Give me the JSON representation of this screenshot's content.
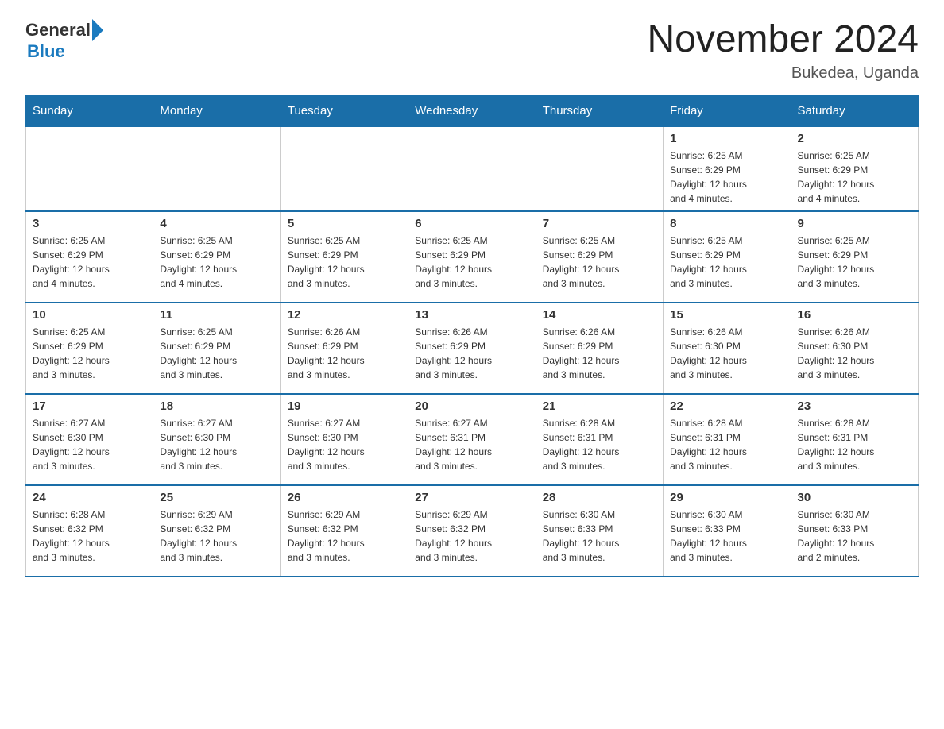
{
  "header": {
    "logo_general": "General",
    "logo_blue": "Blue",
    "title": "November 2024",
    "location": "Bukedea, Uganda"
  },
  "days_of_week": [
    "Sunday",
    "Monday",
    "Tuesday",
    "Wednesday",
    "Thursday",
    "Friday",
    "Saturday"
  ],
  "weeks": [
    [
      {
        "day": "",
        "info": ""
      },
      {
        "day": "",
        "info": ""
      },
      {
        "day": "",
        "info": ""
      },
      {
        "day": "",
        "info": ""
      },
      {
        "day": "",
        "info": ""
      },
      {
        "day": "1",
        "info": "Sunrise: 6:25 AM\nSunset: 6:29 PM\nDaylight: 12 hours\nand 4 minutes."
      },
      {
        "day": "2",
        "info": "Sunrise: 6:25 AM\nSunset: 6:29 PM\nDaylight: 12 hours\nand 4 minutes."
      }
    ],
    [
      {
        "day": "3",
        "info": "Sunrise: 6:25 AM\nSunset: 6:29 PM\nDaylight: 12 hours\nand 4 minutes."
      },
      {
        "day": "4",
        "info": "Sunrise: 6:25 AM\nSunset: 6:29 PM\nDaylight: 12 hours\nand 4 minutes."
      },
      {
        "day": "5",
        "info": "Sunrise: 6:25 AM\nSunset: 6:29 PM\nDaylight: 12 hours\nand 3 minutes."
      },
      {
        "day": "6",
        "info": "Sunrise: 6:25 AM\nSunset: 6:29 PM\nDaylight: 12 hours\nand 3 minutes."
      },
      {
        "day": "7",
        "info": "Sunrise: 6:25 AM\nSunset: 6:29 PM\nDaylight: 12 hours\nand 3 minutes."
      },
      {
        "day": "8",
        "info": "Sunrise: 6:25 AM\nSunset: 6:29 PM\nDaylight: 12 hours\nand 3 minutes."
      },
      {
        "day": "9",
        "info": "Sunrise: 6:25 AM\nSunset: 6:29 PM\nDaylight: 12 hours\nand 3 minutes."
      }
    ],
    [
      {
        "day": "10",
        "info": "Sunrise: 6:25 AM\nSunset: 6:29 PM\nDaylight: 12 hours\nand 3 minutes."
      },
      {
        "day": "11",
        "info": "Sunrise: 6:25 AM\nSunset: 6:29 PM\nDaylight: 12 hours\nand 3 minutes."
      },
      {
        "day": "12",
        "info": "Sunrise: 6:26 AM\nSunset: 6:29 PM\nDaylight: 12 hours\nand 3 minutes."
      },
      {
        "day": "13",
        "info": "Sunrise: 6:26 AM\nSunset: 6:29 PM\nDaylight: 12 hours\nand 3 minutes."
      },
      {
        "day": "14",
        "info": "Sunrise: 6:26 AM\nSunset: 6:29 PM\nDaylight: 12 hours\nand 3 minutes."
      },
      {
        "day": "15",
        "info": "Sunrise: 6:26 AM\nSunset: 6:30 PM\nDaylight: 12 hours\nand 3 minutes."
      },
      {
        "day": "16",
        "info": "Sunrise: 6:26 AM\nSunset: 6:30 PM\nDaylight: 12 hours\nand 3 minutes."
      }
    ],
    [
      {
        "day": "17",
        "info": "Sunrise: 6:27 AM\nSunset: 6:30 PM\nDaylight: 12 hours\nand 3 minutes."
      },
      {
        "day": "18",
        "info": "Sunrise: 6:27 AM\nSunset: 6:30 PM\nDaylight: 12 hours\nand 3 minutes."
      },
      {
        "day": "19",
        "info": "Sunrise: 6:27 AM\nSunset: 6:30 PM\nDaylight: 12 hours\nand 3 minutes."
      },
      {
        "day": "20",
        "info": "Sunrise: 6:27 AM\nSunset: 6:31 PM\nDaylight: 12 hours\nand 3 minutes."
      },
      {
        "day": "21",
        "info": "Sunrise: 6:28 AM\nSunset: 6:31 PM\nDaylight: 12 hours\nand 3 minutes."
      },
      {
        "day": "22",
        "info": "Sunrise: 6:28 AM\nSunset: 6:31 PM\nDaylight: 12 hours\nand 3 minutes."
      },
      {
        "day": "23",
        "info": "Sunrise: 6:28 AM\nSunset: 6:31 PM\nDaylight: 12 hours\nand 3 minutes."
      }
    ],
    [
      {
        "day": "24",
        "info": "Sunrise: 6:28 AM\nSunset: 6:32 PM\nDaylight: 12 hours\nand 3 minutes."
      },
      {
        "day": "25",
        "info": "Sunrise: 6:29 AM\nSunset: 6:32 PM\nDaylight: 12 hours\nand 3 minutes."
      },
      {
        "day": "26",
        "info": "Sunrise: 6:29 AM\nSunset: 6:32 PM\nDaylight: 12 hours\nand 3 minutes."
      },
      {
        "day": "27",
        "info": "Sunrise: 6:29 AM\nSunset: 6:32 PM\nDaylight: 12 hours\nand 3 minutes."
      },
      {
        "day": "28",
        "info": "Sunrise: 6:30 AM\nSunset: 6:33 PM\nDaylight: 12 hours\nand 3 minutes."
      },
      {
        "day": "29",
        "info": "Sunrise: 6:30 AM\nSunset: 6:33 PM\nDaylight: 12 hours\nand 3 minutes."
      },
      {
        "day": "30",
        "info": "Sunrise: 6:30 AM\nSunset: 6:33 PM\nDaylight: 12 hours\nand 2 minutes."
      }
    ]
  ]
}
